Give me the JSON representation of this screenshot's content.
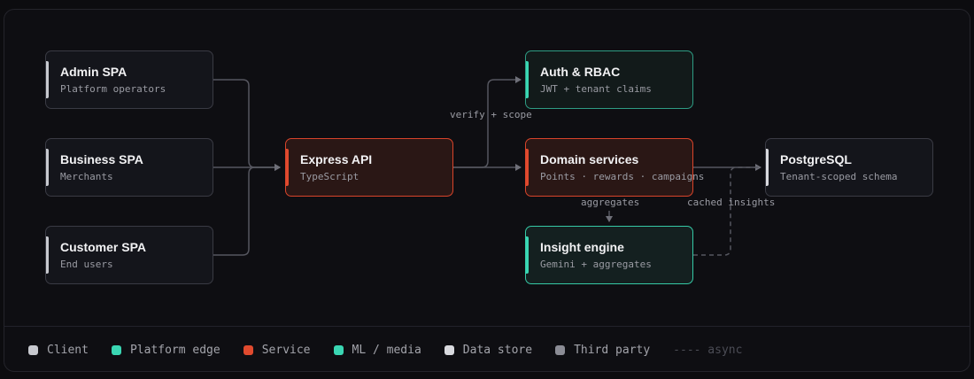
{
  "nodes": {
    "admin_spa": {
      "title": "Admin SPA",
      "subtitle": "Platform operators"
    },
    "business_spa": {
      "title": "Business SPA",
      "subtitle": "Merchants"
    },
    "customer_spa": {
      "title": "Customer SPA",
      "subtitle": "End users"
    },
    "express_api": {
      "title": "Express API",
      "subtitle": "TypeScript"
    },
    "auth_rbac": {
      "title": "Auth & RBAC",
      "subtitle": "JWT + tenant claims"
    },
    "domain_services": {
      "title": "Domain services",
      "subtitle": "Points · rewards · campaigns"
    },
    "insight_engine": {
      "title": "Insight engine",
      "subtitle": "Gemini + aggregates"
    },
    "postgresql": {
      "title": "PostgreSQL",
      "subtitle": "Tenant-scoped schema"
    }
  },
  "edge_labels": {
    "verify_scope": "verify + scope",
    "aggregates": "aggregates",
    "cached_insights": "cached insights"
  },
  "legend": {
    "client": {
      "label": "Client",
      "color": "#c7c9cf"
    },
    "platform_edge": {
      "label": "Platform edge",
      "color": "#3ad6b3"
    },
    "service": {
      "label": "Service",
      "color": "#e04a2e"
    },
    "ml_media": {
      "label": "ML / media",
      "color": "#3ad6b3"
    },
    "data_store": {
      "label": "Data store",
      "color": "#d8d9de"
    },
    "third_party": {
      "label": "Third party",
      "color": "#8b8c95"
    },
    "async": {
      "label": "---- async"
    }
  }
}
